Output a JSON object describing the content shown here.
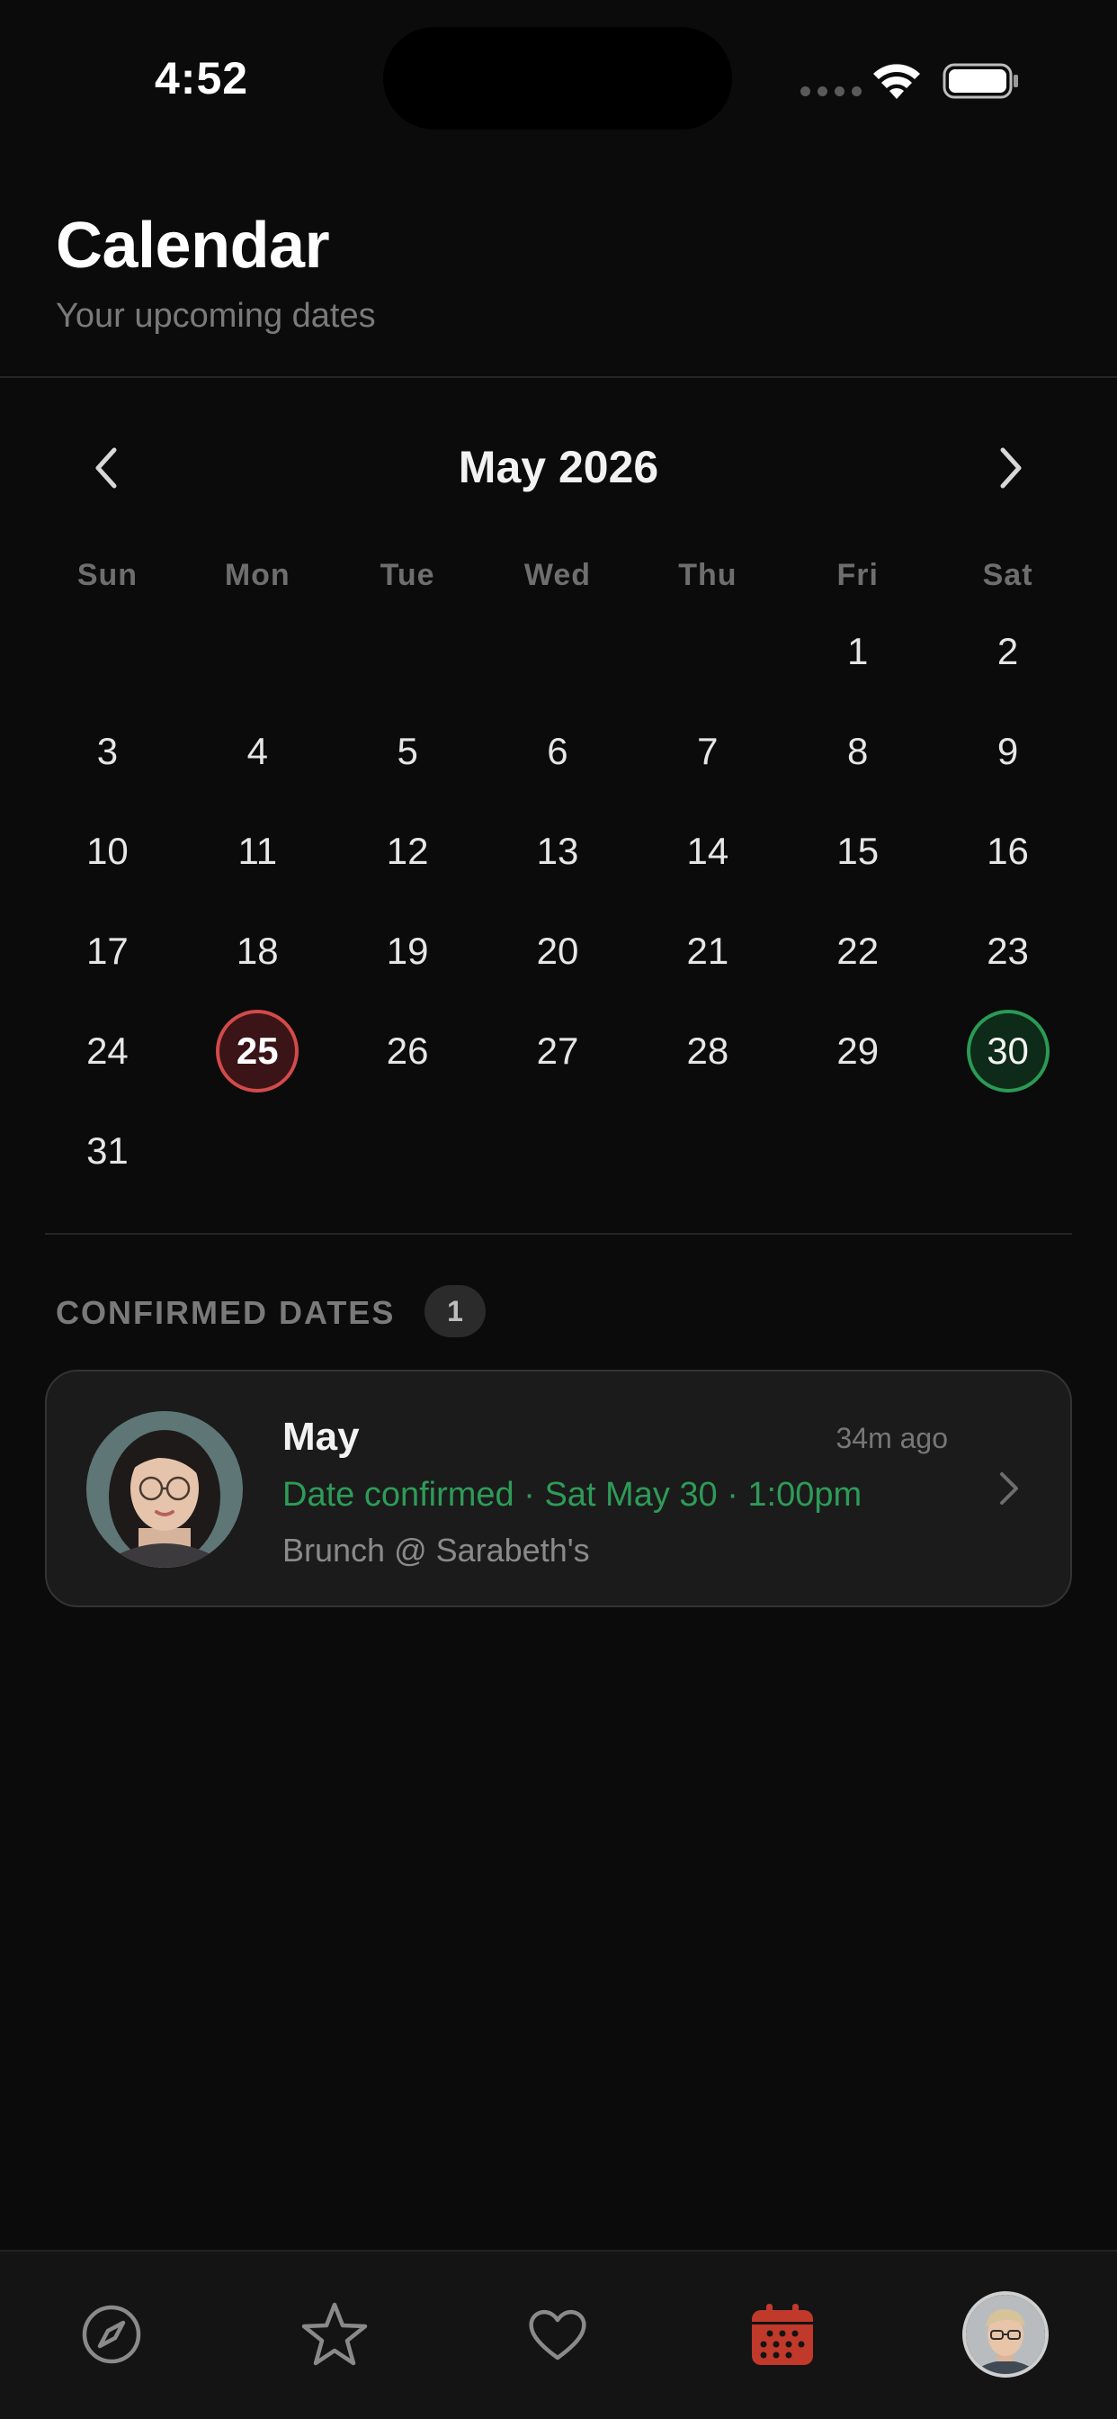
{
  "status_bar": {
    "time": "4:52"
  },
  "header": {
    "title": "Calendar",
    "subtitle": "Your upcoming dates"
  },
  "calendar": {
    "month_label": "May 2026",
    "weekdays": [
      "Sun",
      "Mon",
      "Tue",
      "Wed",
      "Thu",
      "Fri",
      "Sat"
    ],
    "days": [
      "1",
      "2",
      "3",
      "4",
      "5",
      "6",
      "7",
      "8",
      "9",
      "10",
      "11",
      "12",
      "13",
      "14",
      "15",
      "16",
      "17",
      "18",
      "19",
      "20",
      "21",
      "22",
      "23",
      "24",
      "25",
      "26",
      "27",
      "28",
      "29",
      "30",
      "31"
    ],
    "leading_blanks": 5,
    "today": "25",
    "confirmed_day": "30",
    "accent_today": "#d24a4a",
    "accent_confirmed": "#2a9a55"
  },
  "section": {
    "title": "CONFIRMED DATES",
    "count": "1"
  },
  "card": {
    "name": "May",
    "time_ago": "34m ago",
    "status": "Date confirmed · Sat May 30 · 1:00pm",
    "place": "Brunch @ Sarabeth's",
    "status_color": "#2e9b58"
  },
  "tabbar": {
    "items": [
      {
        "icon": "compass-icon"
      },
      {
        "icon": "star-icon"
      },
      {
        "icon": "heart-icon"
      },
      {
        "icon": "calendar-icon",
        "active": true
      },
      {
        "icon": "profile-avatar"
      }
    ],
    "active_color": "#c0392b"
  }
}
